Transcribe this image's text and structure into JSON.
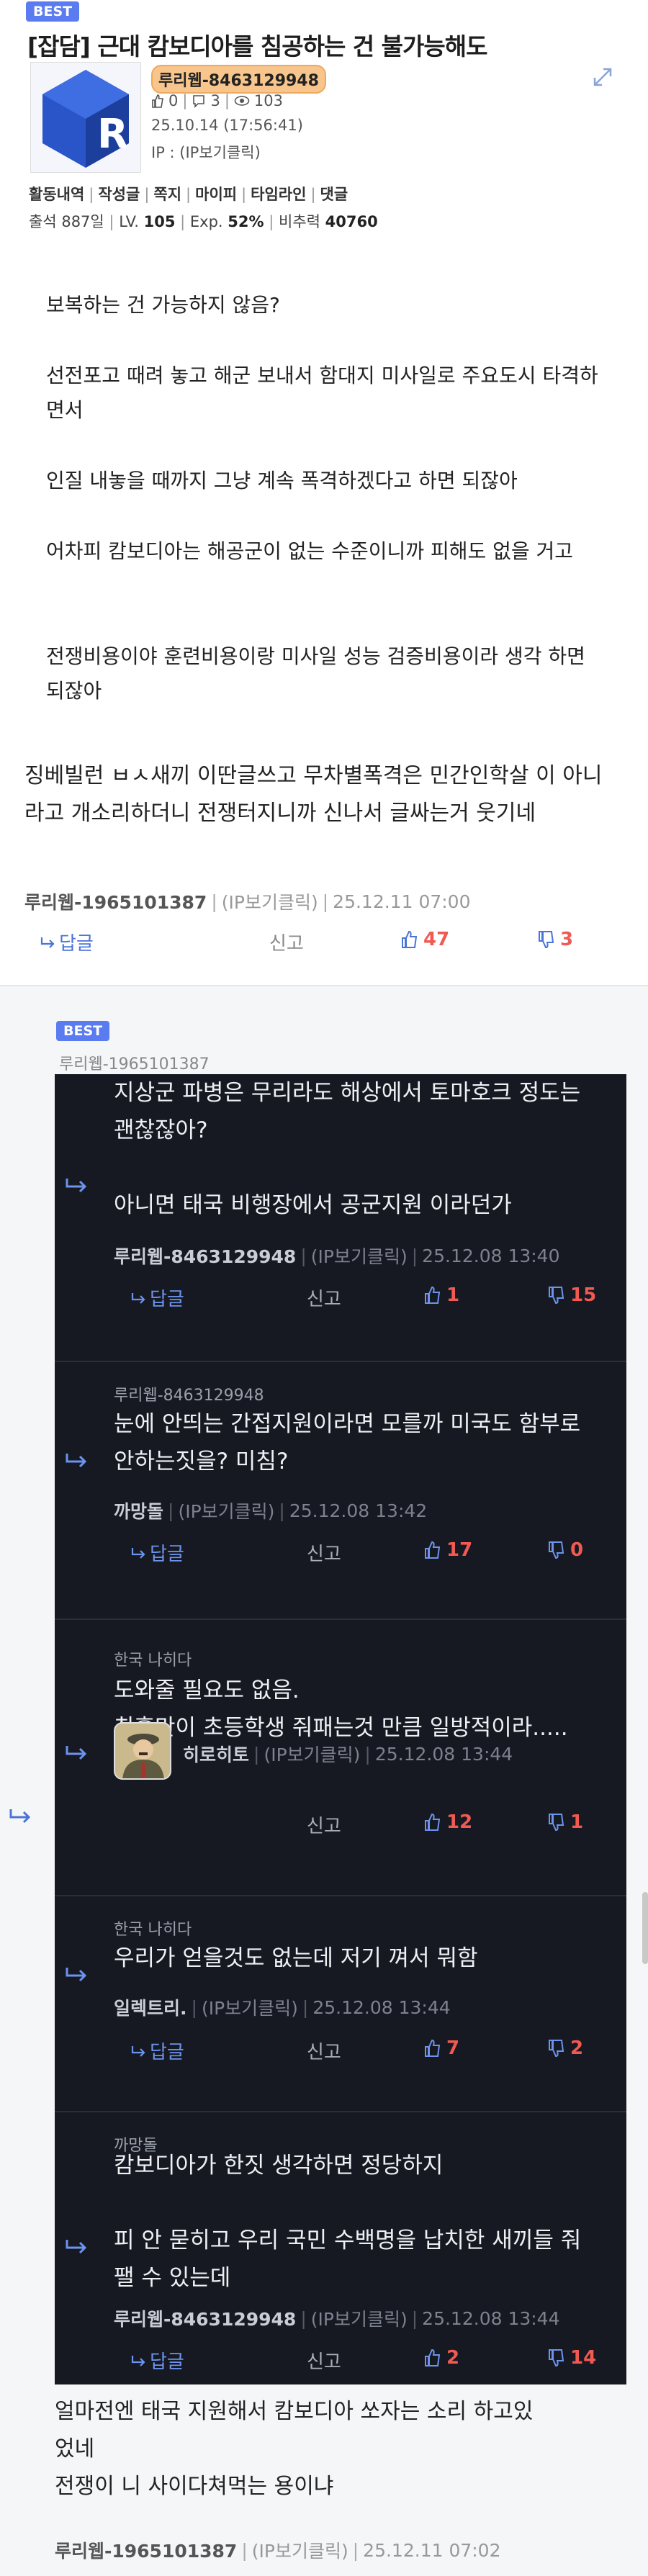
{
  "post": {
    "best_badge": "BEST",
    "title": "[잡담] 근대 캄보디아를 침공하는 건 불가능해도",
    "author": "루리웹-8463129948",
    "likes": "0",
    "comments": "3",
    "views": "103",
    "date": "25.10.14 (17:56:41)",
    "ip_label": "IP : (IP보기클릭)",
    "activity_links": [
      "활동내역",
      "작성글",
      "쪽지",
      "마이피",
      "타임라인",
      "댓글"
    ],
    "stats": {
      "attendance_label": "출석",
      "attendance": "887일",
      "level_label": "LV.",
      "level": "105",
      "exp_label": "Exp.",
      "exp": "52%",
      "ratio_label": "비추력",
      "ratio": "40760"
    },
    "body": [
      "보복하는 건 가능하지 않음?",
      "선전포고 때려 놓고 해군 보내서 함대지 미사일로 주요도시 타격하면서",
      "인질 내놓을 때까지 그냥 계속 폭격하겠다고 하면 되잖아",
      "어차피 캄보디아는 해공군이 없는 수준이니까 피해도 없을 거고",
      "전쟁비용이야 훈련비용이랑 미사일 성능 검증비용이라 생각 하면 되잖아"
    ]
  },
  "top_comment": {
    "text": "징베빌런 ㅂㅅ새끼 이딴글쓰고 무차별폭격은 민간인학살 이 아니라고 개소리하더니 전쟁터지니까 신나서 글싸는거 웃기네",
    "nick": "루리웹-1965101387",
    "ip": "(IP보기클릭)",
    "time": "25.12.11 07:00",
    "reply_label": "답글",
    "report_label": "신고",
    "likes": "47",
    "dislikes": "3"
  },
  "reply_thread": {
    "best_badge": "BEST",
    "parent_nick": "루리웹-1965101387",
    "items": [
      {
        "parent": "",
        "lines": [
          "지상군 파병은 무리라도 해상에서 토마호크 정도는",
          "괜찮잖아?",
          "",
          "아니면 태국 비행장에서 공군지원 이라던가"
        ],
        "nick": "루리웹-8463129948",
        "ip": "(IP보기클릭)",
        "time": "25.12.08 13:40",
        "reply_label": "답글",
        "report_label": "신고",
        "likes": "1",
        "dislikes": "15"
      },
      {
        "parent": "루리웹-8463129948",
        "lines": [
          "눈에 안띄는 간접지원이라면 모를까 미국도 함부로",
          "안하는짓을? 미침?"
        ],
        "nick": "까망돌",
        "ip": "(IP보기클릭)",
        "time": "25.12.08 13:42",
        "reply_label": "답글",
        "report_label": "신고",
        "likes": "17",
        "dislikes": "0"
      },
      {
        "parent": "한국 나히다",
        "lines": [
          "도와줄 필요도 없음.",
          "최홍만이 초등학생 줘패는것 만큼 일방적이라....."
        ],
        "nick": "히로히토",
        "ip": "(IP보기클릭)",
        "time": "25.12.08 13:44",
        "reply_label": "",
        "report_label": "신고",
        "likes": "12",
        "dislikes": "1"
      },
      {
        "parent": "한국 나히다",
        "lines": [
          "우리가 얻을것도 없는데 저기 껴서 뭐함"
        ],
        "nick": "일렉트리.",
        "ip": "(IP보기클릭)",
        "time": "25.12.08 13:44",
        "reply_label": "답글",
        "report_label": "신고",
        "likes": "7",
        "dislikes": "2"
      },
      {
        "parent": "까망돌",
        "lines": [
          "캄보디아가 한짓 생각하면 정당하지",
          "",
          "피 안 묻히고 우리 국민 수백명을 납치한 새끼들 줘",
          "팰 수 있는데"
        ],
        "nick": "루리웹-8463129948",
        "ip": "(IP보기클릭)",
        "time": "25.12.08 13:44",
        "reply_label": "답글",
        "report_label": "신고",
        "likes": "2",
        "dislikes": "14"
      }
    ]
  },
  "last_comment": {
    "text_lines": [
      "얼마전엔 태국 지원해서 캄보디아 쏘자는 소리 하고있",
      "었네",
      "전쟁이 니 사이다쳐먹는 용이냐"
    ],
    "nick": "루리웹-1965101387",
    "ip": "(IP보기클릭)",
    "time": "25.12.11 07:02"
  },
  "colors": {
    "best": "#5b7bf0",
    "like": "#f05a52",
    "reply": "#4a74d8",
    "dark_panel": "#171922"
  }
}
